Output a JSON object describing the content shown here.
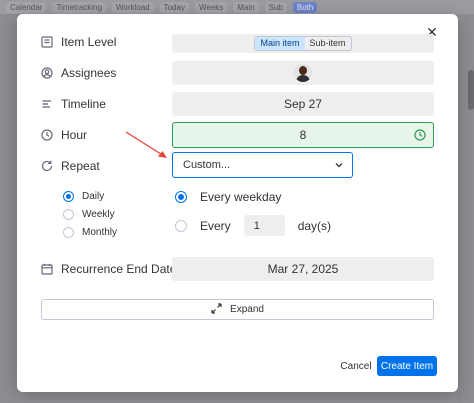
{
  "background": {
    "tabs": [
      "Calendar",
      "Timetracking",
      "Workload",
      "Today",
      "Weeks",
      "Main",
      "Sub",
      "Both"
    ],
    "active_tab": "Both"
  },
  "modal": {
    "rows": {
      "item_level": {
        "label": "Item Level",
        "options": [
          "Main item",
          "Sub-item"
        ],
        "selected": "Main item",
        "icon": "item-level-icon"
      },
      "assignees": {
        "label": "Assignees",
        "icon": "person-icon"
      },
      "timeline": {
        "label": "Timeline",
        "value": "Sep 27",
        "icon": "timeline-icon"
      },
      "hour": {
        "label": "Hour",
        "value": "8",
        "icon": "clock-icon"
      },
      "repeat": {
        "label": "Repeat",
        "value": "Custom...",
        "icon": "repeat-icon"
      },
      "recurrence_end": {
        "label": "Recurrence End Date",
        "value": "Mar 27, 2025",
        "icon": "calendar-icon"
      }
    },
    "frequency": {
      "options": [
        "Daily",
        "Weekly",
        "Monthly"
      ],
      "selected": "Daily"
    },
    "daily": {
      "every_weekday": "Every weekday",
      "every_label": "Every",
      "every_value": "1",
      "unit": "day(s)",
      "selected": "Every weekday"
    },
    "expand_label": "Expand",
    "cancel_label": "Cancel",
    "create_label": "Create Item"
  },
  "colors": {
    "primary": "#0073ea",
    "success": "#2f9a56",
    "annotation_arrow": "#e8453c"
  }
}
